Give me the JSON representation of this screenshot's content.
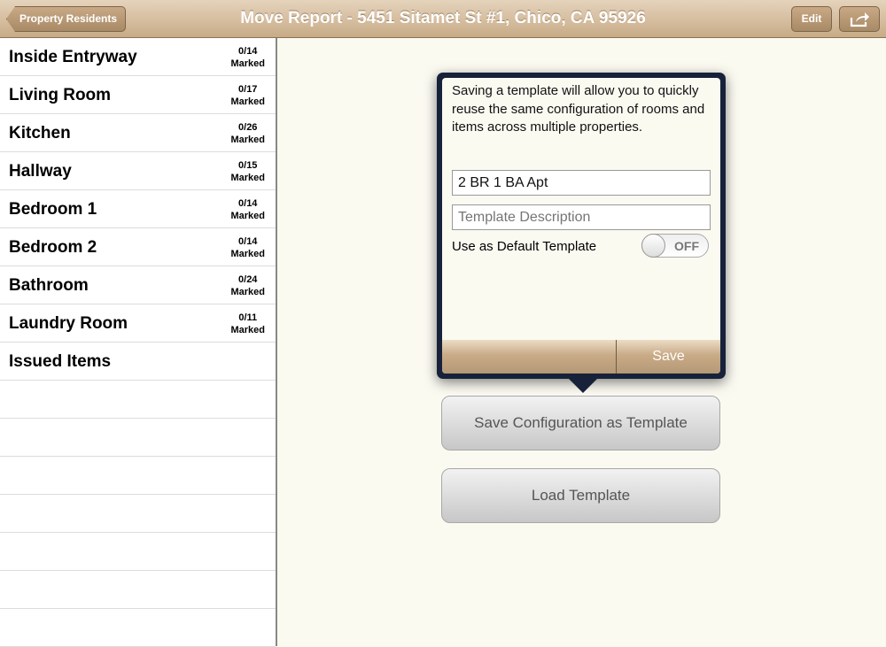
{
  "nav": {
    "back": "Property Residents",
    "title": "Move Report - 5451 Sitamet St #1, Chico, CA 95926",
    "edit": "Edit"
  },
  "rooms": [
    {
      "name": "Inside Entryway",
      "count": "0/14",
      "marked": "Marked"
    },
    {
      "name": "Living Room",
      "count": "0/17",
      "marked": "Marked"
    },
    {
      "name": "Kitchen",
      "count": "0/26",
      "marked": "Marked"
    },
    {
      "name": "Hallway",
      "count": "0/15",
      "marked": "Marked"
    },
    {
      "name": "Bedroom 1",
      "count": "0/14",
      "marked": "Marked"
    },
    {
      "name": "Bedroom 2",
      "count": "0/14",
      "marked": "Marked"
    },
    {
      "name": "Bathroom",
      "count": "0/24",
      "marked": "Marked"
    },
    {
      "name": "Laundry Room",
      "count": "0/11",
      "marked": "Marked"
    },
    {
      "name": "Issued Items"
    }
  ],
  "popover": {
    "description": "Saving a template will allow you to quickly reuse the same configuration of rooms and items across multiple properties.",
    "name_value": "2 BR 1 BA Apt",
    "desc_placeholder": "Template Description",
    "default_label": "Use as Default Template",
    "toggle": "OFF",
    "save": "Save"
  },
  "buttons": {
    "save_config": "Save Configuration as Template",
    "load": "Load Template"
  }
}
